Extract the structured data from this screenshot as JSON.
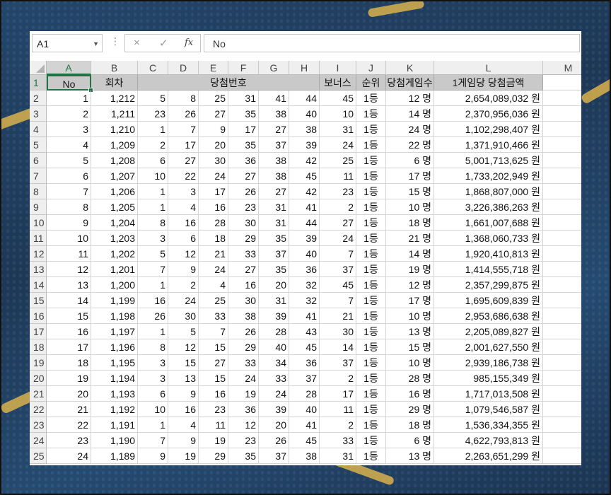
{
  "name_box": "A1",
  "formula_bar": {
    "cancel_icon": "×",
    "enter_icon": "✓",
    "fx_icon": "fx",
    "value": "No"
  },
  "columns": [
    "A",
    "B",
    "C",
    "D",
    "E",
    "F",
    "G",
    "H",
    "I",
    "J",
    "K",
    "L",
    "M"
  ],
  "header": {
    "no": "No",
    "round": "회차",
    "winning_numbers": "당첨번호",
    "bonus": "보너스",
    "rank": "순위",
    "winner_games": "당첨게임수",
    "prize_per_game": "1게임당 당첨금액"
  },
  "rows": [
    [
      "1",
      "1,212",
      "5",
      "8",
      "25",
      "31",
      "41",
      "44",
      "45",
      "1등",
      "12 명",
      "2,654,089,032 원"
    ],
    [
      "2",
      "1,211",
      "23",
      "26",
      "27",
      "35",
      "38",
      "40",
      "10",
      "1등",
      "14 명",
      "2,370,956,036 원"
    ],
    [
      "3",
      "1,210",
      "1",
      "7",
      "9",
      "17",
      "27",
      "38",
      "31",
      "1등",
      "24 명",
      "1,102,298,407 원"
    ],
    [
      "4",
      "1,209",
      "2",
      "17",
      "20",
      "35",
      "37",
      "39",
      "24",
      "1등",
      "22 명",
      "1,371,910,466 원"
    ],
    [
      "5",
      "1,208",
      "6",
      "27",
      "30",
      "36",
      "38",
      "42",
      "25",
      "1등",
      "6 명",
      "5,001,713,625 원"
    ],
    [
      "6",
      "1,207",
      "10",
      "22",
      "24",
      "27",
      "38",
      "45",
      "11",
      "1등",
      "17 명",
      "1,733,202,949 원"
    ],
    [
      "7",
      "1,206",
      "1",
      "3",
      "17",
      "26",
      "27",
      "42",
      "23",
      "1등",
      "15 명",
      "1,868,807,000 원"
    ],
    [
      "8",
      "1,205",
      "1",
      "4",
      "16",
      "23",
      "31",
      "41",
      "2",
      "1등",
      "10 명",
      "3,226,386,263 원"
    ],
    [
      "9",
      "1,204",
      "8",
      "16",
      "28",
      "30",
      "31",
      "44",
      "27",
      "1등",
      "18 명",
      "1,661,007,688 원"
    ],
    [
      "10",
      "1,203",
      "3",
      "6",
      "18",
      "29",
      "35",
      "39",
      "24",
      "1등",
      "21 명",
      "1,368,060,733 원"
    ],
    [
      "11",
      "1,202",
      "5",
      "12",
      "21",
      "33",
      "37",
      "40",
      "7",
      "1등",
      "14 명",
      "1,920,410,813 원"
    ],
    [
      "12",
      "1,201",
      "7",
      "9",
      "24",
      "27",
      "35",
      "36",
      "37",
      "1등",
      "19 명",
      "1,414,555,718 원"
    ],
    [
      "13",
      "1,200",
      "1",
      "2",
      "4",
      "16",
      "20",
      "32",
      "45",
      "1등",
      "12 명",
      "2,357,299,875 원"
    ],
    [
      "14",
      "1,199",
      "16",
      "24",
      "25",
      "30",
      "31",
      "32",
      "7",
      "1등",
      "17 명",
      "1,695,609,839 원"
    ],
    [
      "15",
      "1,198",
      "26",
      "30",
      "33",
      "38",
      "39",
      "41",
      "21",
      "1등",
      "10 명",
      "2,953,686,638 원"
    ],
    [
      "16",
      "1,197",
      "1",
      "5",
      "7",
      "26",
      "28",
      "43",
      "30",
      "1등",
      "13 명",
      "2,205,089,827 원"
    ],
    [
      "17",
      "1,196",
      "8",
      "12",
      "15",
      "29",
      "40",
      "45",
      "14",
      "1등",
      "15 명",
      "2,001,627,550 원"
    ],
    [
      "18",
      "1,195",
      "3",
      "15",
      "27",
      "33",
      "34",
      "36",
      "37",
      "1등",
      "10 명",
      "2,939,186,738 원"
    ],
    [
      "19",
      "1,194",
      "3",
      "13",
      "15",
      "24",
      "33",
      "37",
      "2",
      "1등",
      "28 명",
      "985,155,349 원"
    ],
    [
      "20",
      "1,193",
      "6",
      "9",
      "16",
      "19",
      "24",
      "28",
      "17",
      "1등",
      "16 명",
      "1,717,013,508 원"
    ],
    [
      "21",
      "1,192",
      "10",
      "16",
      "23",
      "36",
      "39",
      "40",
      "11",
      "1등",
      "29 명",
      "1,079,546,587 원"
    ],
    [
      "22",
      "1,191",
      "1",
      "4",
      "11",
      "12",
      "20",
      "41",
      "2",
      "1등",
      "18 명",
      "1,536,334,355 원"
    ],
    [
      "23",
      "1,190",
      "7",
      "9",
      "19",
      "23",
      "26",
      "45",
      "33",
      "1등",
      "6 명",
      "4,622,793,813 원"
    ],
    [
      "24",
      "1,189",
      "9",
      "19",
      "29",
      "35",
      "37",
      "38",
      "31",
      "1등",
      "13 명",
      "2,263,651,299 원"
    ]
  ]
}
